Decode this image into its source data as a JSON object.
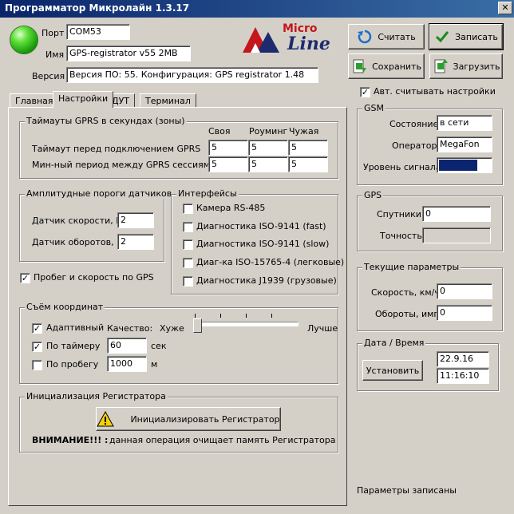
{
  "window": {
    "title": "Программатор Микролайн 1.3.17",
    "close": "✕"
  },
  "logo": {
    "micro": "Micro",
    "line": "Line"
  },
  "conn": {
    "port_label": "Порт",
    "port": "COM53",
    "name_label": "Имя",
    "name": "GPS-registrator v55 2MB",
    "version_label": "Версия",
    "version": "Версия ПО: 55. Конфигурация: GPS registrator 1.48"
  },
  "toolbar": {
    "read": "Считать",
    "write": "Записать",
    "save": "Сохранить",
    "load": "Загрузить"
  },
  "tabs": [
    "Главная",
    "Настройки",
    "ДУТ",
    "Терминал"
  ],
  "gprs": {
    "title": "Таймауты GPRS в секундах (зоны)",
    "col_own": "Своя",
    "col_roaming": "Роуминг",
    "col_foreign": "Чужая",
    "row1_label": "Таймаут перед подключением GPRS",
    "row1": [
      "5",
      "5",
      "5"
    ],
    "row2_label": "Мин-ный период между GPRS сессиями",
    "row2": [
      "5",
      "5",
      "5"
    ]
  },
  "sensors": {
    "title": "Амплитудные пороги датчиков",
    "speed_label": "Датчик скорости, В",
    "speed": "2",
    "rpm_label": "Датчик оборотов, В",
    "rpm": "2"
  },
  "mileage": {
    "label": "Пробег и скорость по GPS",
    "checked": true
  },
  "interfaces": {
    "title": "Интерфейсы",
    "items": [
      "Камера RS-485",
      "Диагностика ISO-9141 (fast)",
      "Диагностика ISO-9141 (slow)",
      "Диаг-ка ISO-15765-4 (легковые)",
      "Диагностика J1939 (грузовые)"
    ]
  },
  "coords": {
    "title": "Съём координат",
    "adaptive_label": "Адаптивный",
    "adaptive_checked": true,
    "quality_label": "Качество:",
    "worse": "Хуже",
    "better": "Лучше",
    "quality_level": 0,
    "timer_label": "По таймеру",
    "timer_checked": true,
    "timer_value": "60",
    "timer_unit": "сек",
    "mileage_label": "По пробегу",
    "mileage_checked": false,
    "mileage_value": "1000",
    "mileage_unit": "м"
  },
  "init": {
    "title": "Инициализация Регистратора",
    "button": "Инициализировать Регистратор",
    "warn_bold": "ВНИМАНИЕ!!! :",
    "warn_text": "данная операция очищает память Регистратора"
  },
  "auto_read": {
    "label": "Авт. считывать настройки",
    "checked": true
  },
  "gsm": {
    "title": "GSM",
    "state_label": "Состояние",
    "state": "в сети",
    "operator_label": "Оператор",
    "operator": "MegaFon",
    "signal_label": "Уровень сигнала",
    "signal_level": 0.75,
    "signal_color": "#0a2470"
  },
  "gps": {
    "title": "GPS",
    "sats_label": "Спутники",
    "sats": "0",
    "accuracy_label": "Точность",
    "accuracy": ""
  },
  "current": {
    "title": "Текущие параметры",
    "speed_label": "Скорость, км/ч",
    "speed": "0",
    "rpm_label": "Обороты, имп",
    "rpm": "0"
  },
  "datetime": {
    "title": "Дата / Время",
    "set": "Установить",
    "date": "22.9.16",
    "time": "11:16:10"
  },
  "status": {
    "text": "Параметры записаны"
  }
}
